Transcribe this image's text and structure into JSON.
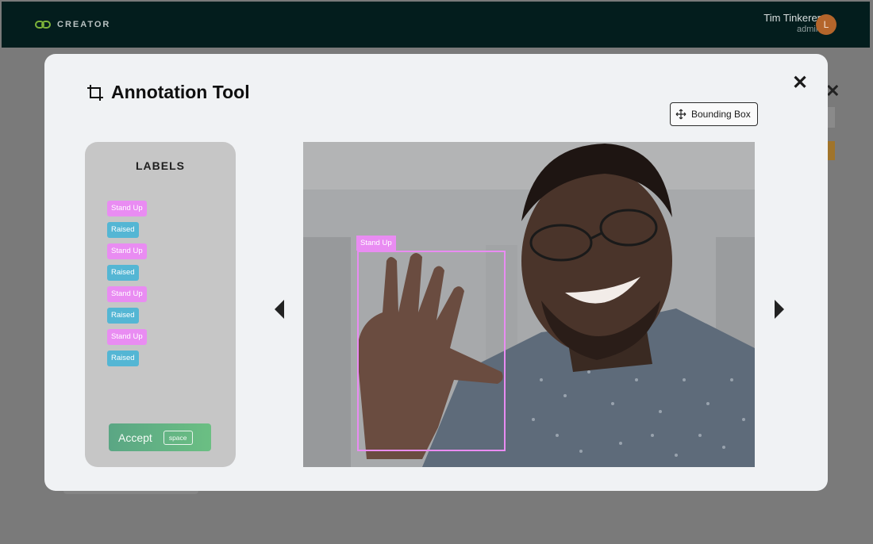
{
  "app": {
    "brand": "CREATOR"
  },
  "user": {
    "name": "Tim Tinkerer",
    "role": "admin",
    "avatar_initial": "L"
  },
  "modal": {
    "title": "Annotation Tool",
    "tool_button": "Bounding Box",
    "labels_heading": "LABELS",
    "labels": [
      {
        "text": "Stand Up",
        "color": "#e98cf2"
      },
      {
        "text": "Raised",
        "color": "#54b6d4"
      },
      {
        "text": "Stand Up",
        "color": "#e98cf2"
      },
      {
        "text": "Raised",
        "color": "#54b6d4"
      },
      {
        "text": "Stand Up",
        "color": "#e98cf2"
      },
      {
        "text": "Raised",
        "color": "#54b6d4"
      },
      {
        "text": "Stand Up",
        "color": "#e98cf2"
      },
      {
        "text": "Raised",
        "color": "#54b6d4"
      }
    ],
    "accept": {
      "label": "Accept",
      "shortcut": "space"
    },
    "annotation": {
      "label": "Stand Up"
    }
  },
  "icons": {
    "brand": "link-icon",
    "title": "crop-icon",
    "tool": "move-icon",
    "close": "close-icon",
    "prev": "chevron-left-icon",
    "next": "chevron-right-icon"
  },
  "colors": {
    "topbar": "#031d1d",
    "modal_bg": "#f0f2f4",
    "label_pink": "#e98cf2",
    "label_blue": "#54b6d4",
    "accept_green": "#5aa684",
    "avatar": "#b4652b"
  }
}
